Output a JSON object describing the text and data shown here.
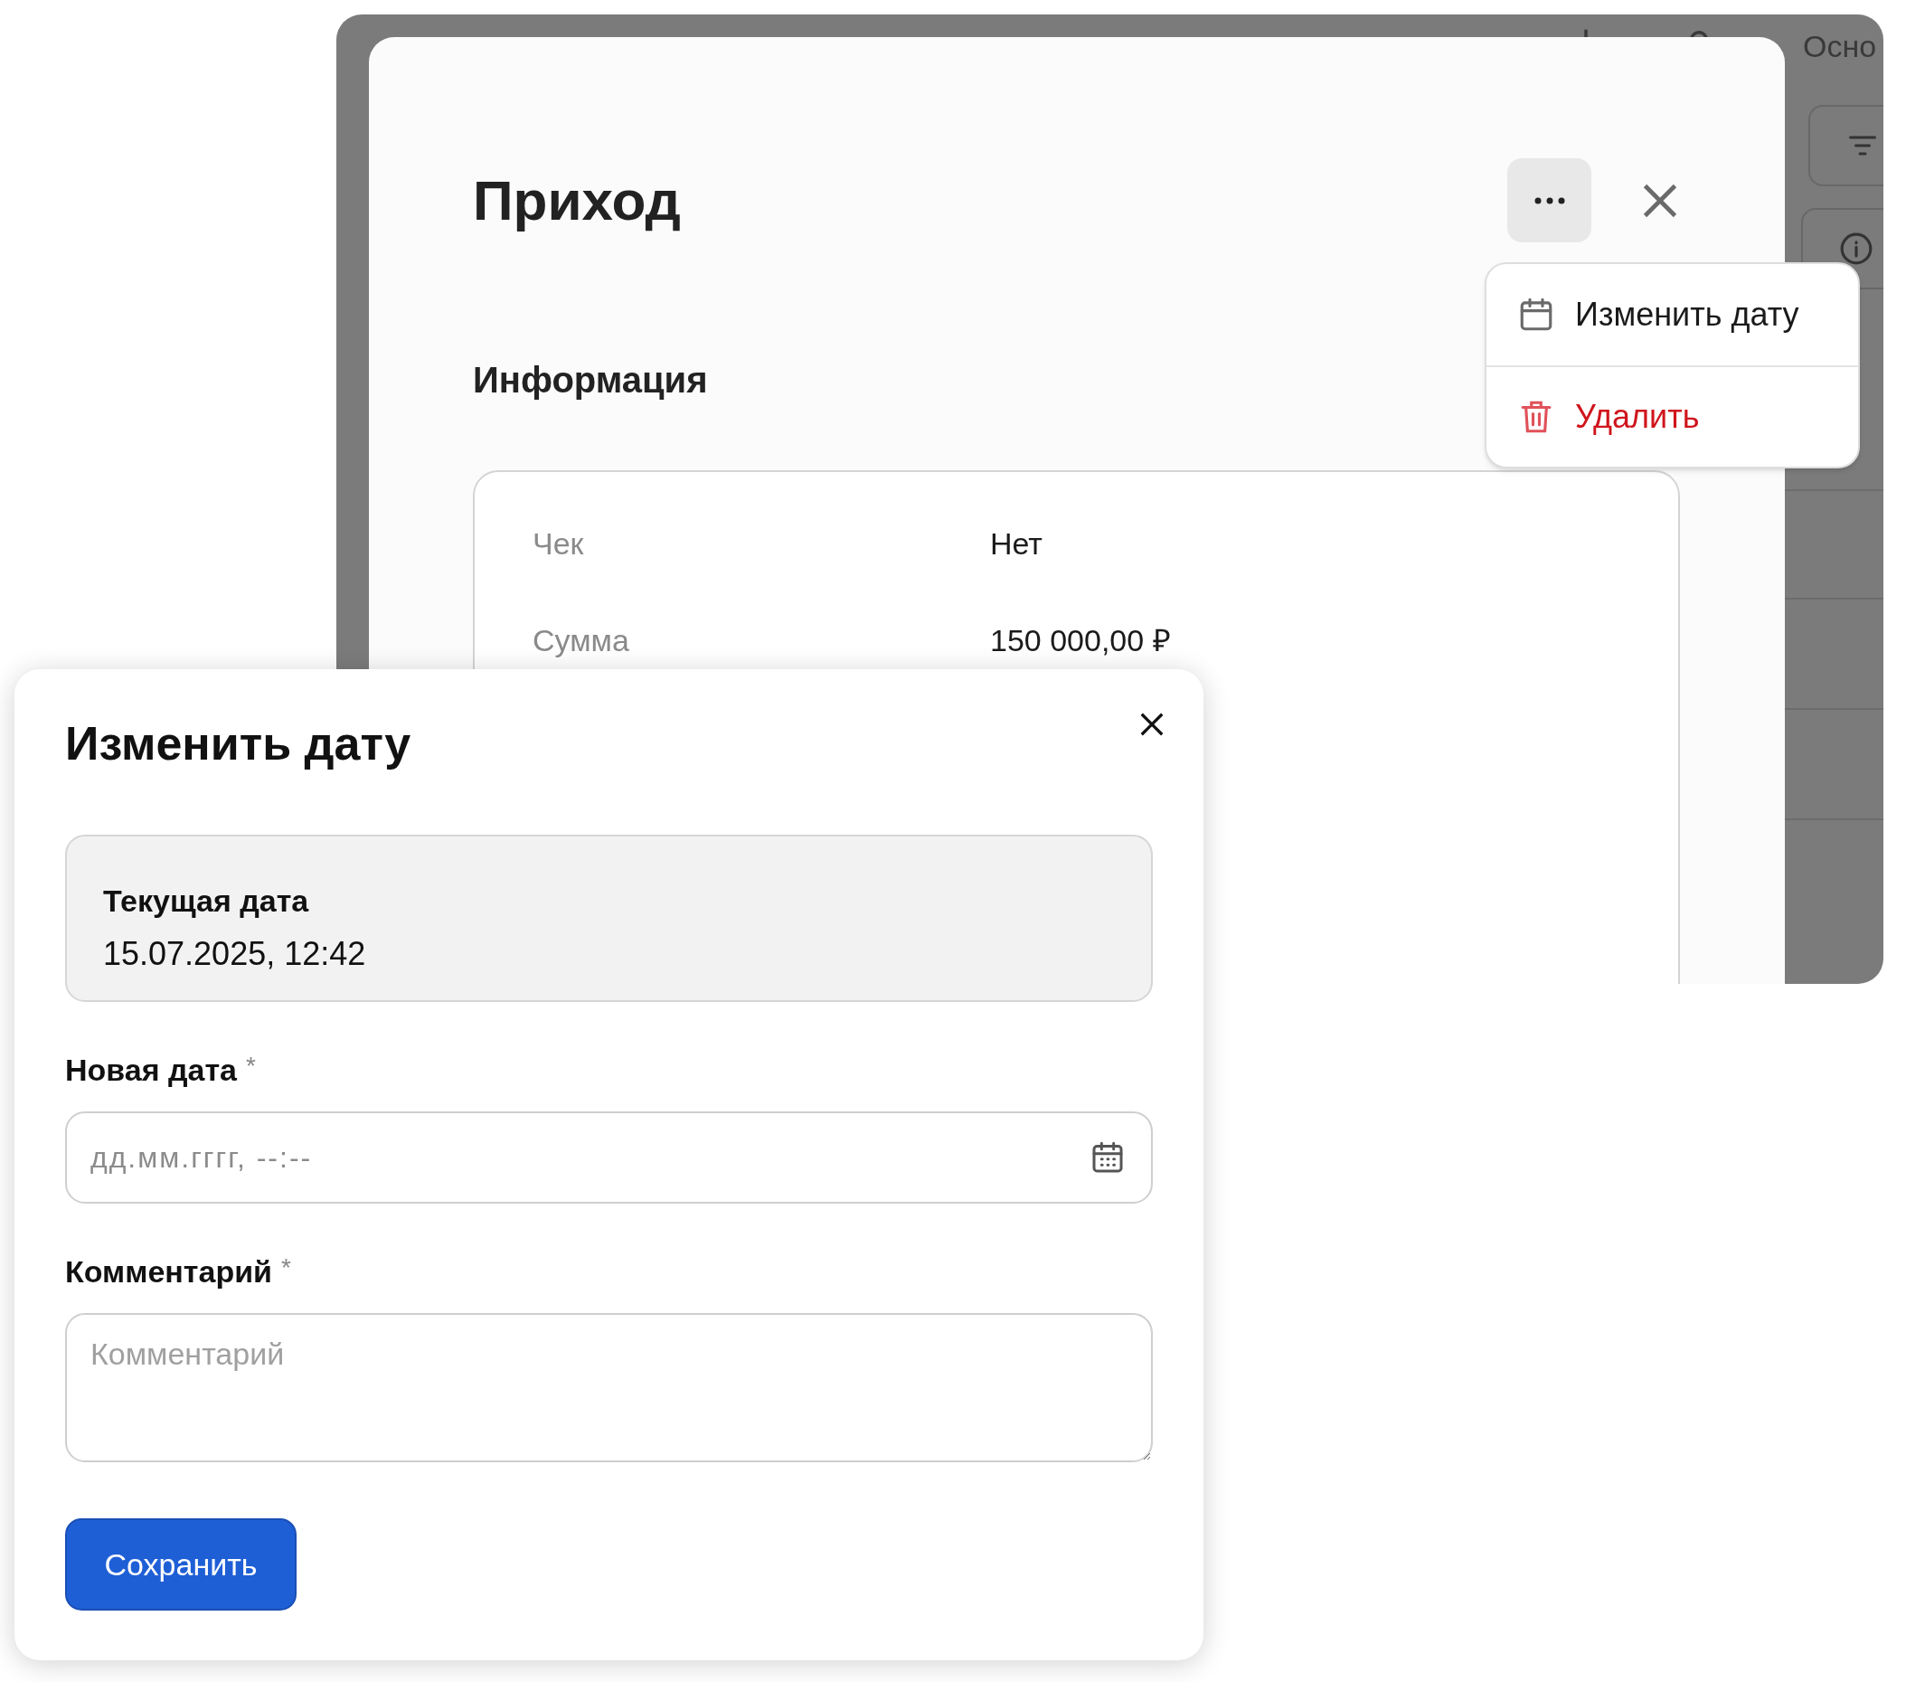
{
  "background_window": {
    "right_label": "Осно"
  },
  "modal": {
    "title": "Приход",
    "section_title": "Информация",
    "info_rows": [
      {
        "label": "Чек",
        "value": "Нет"
      },
      {
        "label": "Сумма",
        "value": "150 000,00 ₽"
      }
    ]
  },
  "menu": {
    "items": [
      {
        "label": "Изменить дату",
        "kind": "calendar"
      },
      {
        "label": "Удалить",
        "kind": "delete"
      }
    ]
  },
  "dialog": {
    "title": "Изменить дату",
    "current": {
      "label": "Текущая дата",
      "value": "15.07.2025, 12:42"
    },
    "fields": [
      {
        "label": "Новая дата",
        "required_mark": "*",
        "kind": "datetime",
        "placeholder": "дд.мм.гггг, --:--"
      },
      {
        "label": "Комментарий",
        "required_mark": "*",
        "kind": "textarea",
        "placeholder": "Комментарий"
      }
    ],
    "save_button": "Сохранить"
  }
}
